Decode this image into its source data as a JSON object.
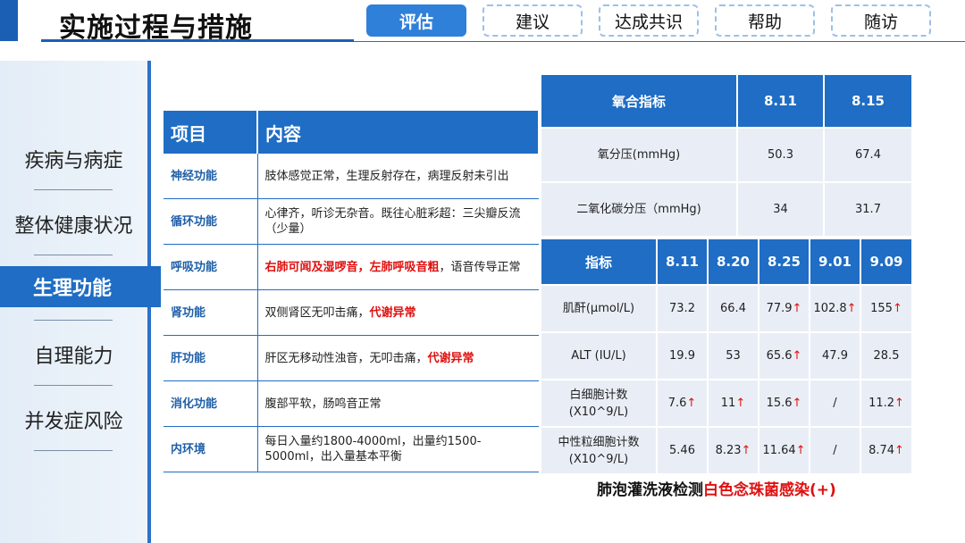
{
  "header": {
    "title": "实施过程与措施",
    "tabs": [
      {
        "label": "评估",
        "active": true
      },
      {
        "label": "建议"
      },
      {
        "label": "达成共识"
      },
      {
        "label": "帮助"
      },
      {
        "label": "随访"
      }
    ]
  },
  "sidebar": {
    "items": [
      {
        "label": "疾病与病症"
      },
      {
        "label": "整体健康状况"
      },
      {
        "label": "生理功能",
        "active": true
      },
      {
        "label": "自理能力"
      },
      {
        "label": "并发症风险"
      }
    ]
  },
  "function_table": {
    "headers": [
      "项目",
      "内容"
    ],
    "rows": [
      {
        "item": "神经功能",
        "content": "肢体感觉正常，生理反射存在，病理反射未引出"
      },
      {
        "item": "循环功能",
        "content": "心律齐，听诊无杂音。既往心脏彩超：三尖瓣反流（少量）"
      },
      {
        "item": "呼吸功能",
        "content_red1": "右肺可闻及湿啰音，",
        "content_red2": "左肺呼吸音粗",
        "content_tail": "，语音传导正常"
      },
      {
        "item": "肾功能",
        "content": "双侧肾区无叩击痛，",
        "content_red": "代谢异常"
      },
      {
        "item": "肝功能",
        "content": "肝区无移动性浊音，无叩击痛，",
        "content_red": "代谢异常"
      },
      {
        "item": "消化功能",
        "content": "腹部平软，肠鸣音正常"
      },
      {
        "item": "内环境",
        "content": "每日入量约1800-4000ml，出量约1500-5000ml，出入量基本平衡"
      }
    ]
  },
  "oxygen_table": {
    "headers": [
      "氧合指标",
      "8.11",
      "8.15"
    ],
    "rows": [
      {
        "label": "氧分压(mmHg)",
        "v1": "50.3",
        "v2": "67.4"
      },
      {
        "label": "二氧化碳分压（mmHg)",
        "v1": "34",
        "v2": "31.7"
      }
    ]
  },
  "lab_table": {
    "headers": [
      "指标",
      "8.11",
      "8.20",
      "8.25",
      "9.01",
      "9.09"
    ],
    "rows": [
      {
        "label": "肌酐(μmol/L)",
        "values": [
          "73.2",
          "66.4",
          "77.9",
          "102.8",
          "155"
        ],
        "up": [
          false,
          false,
          true,
          true,
          true
        ]
      },
      {
        "label": "ALT (IU/L)",
        "values": [
          "19.9",
          "53",
          "65.6",
          "47.9",
          "28.5"
        ],
        "up": [
          false,
          false,
          true,
          false,
          false
        ]
      },
      {
        "label": "白细胞计数(X10^9/L)",
        "values": [
          "7.6",
          "11",
          "15.6",
          "/",
          "11.2"
        ],
        "up": [
          true,
          true,
          true,
          false,
          true
        ]
      },
      {
        "label": "中性粒细胞计数(X10^9/L)",
        "values": [
          "5.46",
          "8.23",
          "11.64",
          "/",
          "8.74"
        ],
        "up": [
          false,
          true,
          true,
          false,
          true
        ]
      }
    ]
  },
  "footnote": {
    "prefix": "肺泡灌洗液检测",
    "highlight": "白色念珠菌感染(+)"
  },
  "colors": {
    "primary": "#1f6dc4",
    "alert": "#e01010"
  }
}
